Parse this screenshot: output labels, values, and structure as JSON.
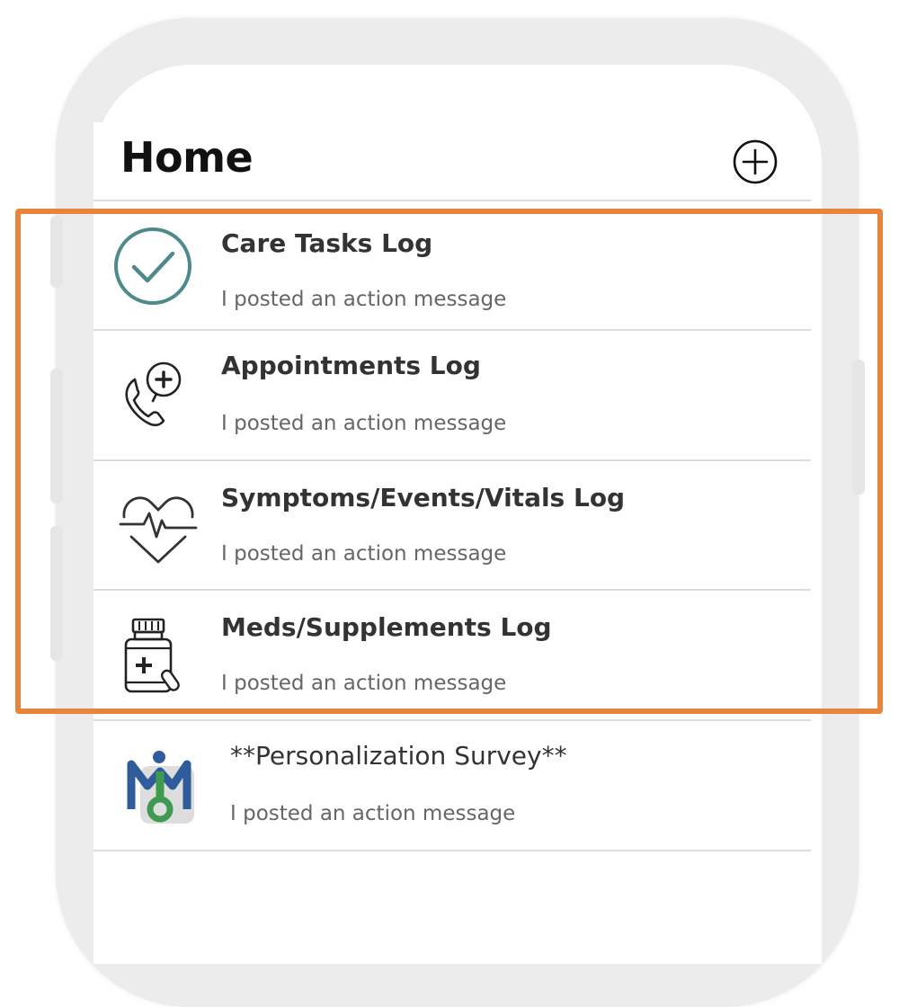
{
  "header": {
    "title": "Home"
  },
  "feed": [
    {
      "title": "Care Tasks Log",
      "subtitle": "I posted an action message",
      "icon": "check-circle-icon"
    },
    {
      "title": "Appointments Log",
      "subtitle": "I posted an action message",
      "icon": "phone-medical-icon"
    },
    {
      "title": "Symptoms/Events/Vitals Log",
      "subtitle": "I posted an action message",
      "icon": "heart-pulse-icon"
    },
    {
      "title": "Meds/Supplements Log",
      "subtitle": "I posted an action message",
      "icon": "medicine-bottle-icon"
    },
    {
      "title": "**Personalization Survey**",
      "subtitle": "I posted an action message",
      "icon": "app-logo-icon"
    }
  ],
  "colors": {
    "highlight": "#e8843c",
    "check_accent": "#4f8a8b",
    "logo_blue": "#2f5d9b",
    "logo_green": "#3f9a4f"
  }
}
